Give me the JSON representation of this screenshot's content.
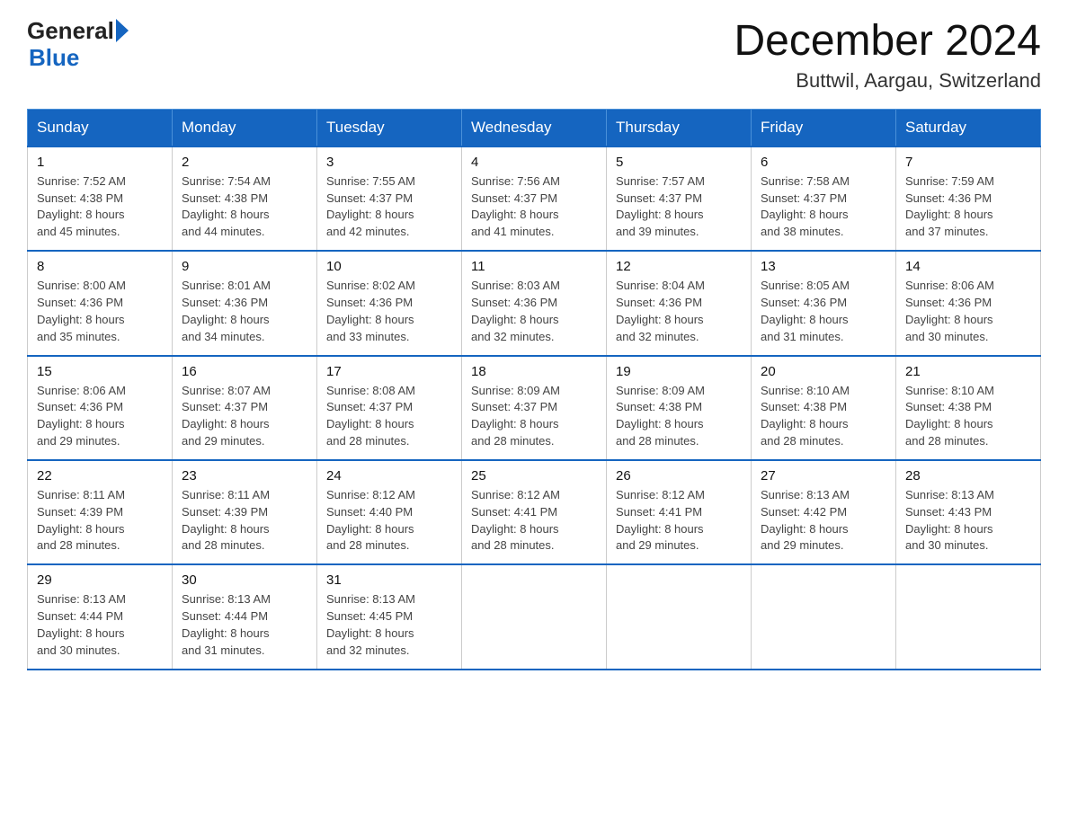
{
  "header": {
    "logo_general": "General",
    "logo_blue": "Blue",
    "month_title": "December 2024",
    "location": "Buttwil, Aargau, Switzerland"
  },
  "weekdays": [
    "Sunday",
    "Monday",
    "Tuesday",
    "Wednesday",
    "Thursday",
    "Friday",
    "Saturday"
  ],
  "weeks": [
    [
      {
        "day": "1",
        "sunrise": "7:52 AM",
        "sunset": "4:38 PM",
        "daylight": "8 hours and 45 minutes."
      },
      {
        "day": "2",
        "sunrise": "7:54 AM",
        "sunset": "4:38 PM",
        "daylight": "8 hours and 44 minutes."
      },
      {
        "day": "3",
        "sunrise": "7:55 AM",
        "sunset": "4:37 PM",
        "daylight": "8 hours and 42 minutes."
      },
      {
        "day": "4",
        "sunrise": "7:56 AM",
        "sunset": "4:37 PM",
        "daylight": "8 hours and 41 minutes."
      },
      {
        "day": "5",
        "sunrise": "7:57 AM",
        "sunset": "4:37 PM",
        "daylight": "8 hours and 39 minutes."
      },
      {
        "day": "6",
        "sunrise": "7:58 AM",
        "sunset": "4:37 PM",
        "daylight": "8 hours and 38 minutes."
      },
      {
        "day": "7",
        "sunrise": "7:59 AM",
        "sunset": "4:36 PM",
        "daylight": "8 hours and 37 minutes."
      }
    ],
    [
      {
        "day": "8",
        "sunrise": "8:00 AM",
        "sunset": "4:36 PM",
        "daylight": "8 hours and 35 minutes."
      },
      {
        "day": "9",
        "sunrise": "8:01 AM",
        "sunset": "4:36 PM",
        "daylight": "8 hours and 34 minutes."
      },
      {
        "day": "10",
        "sunrise": "8:02 AM",
        "sunset": "4:36 PM",
        "daylight": "8 hours and 33 minutes."
      },
      {
        "day": "11",
        "sunrise": "8:03 AM",
        "sunset": "4:36 PM",
        "daylight": "8 hours and 32 minutes."
      },
      {
        "day": "12",
        "sunrise": "8:04 AM",
        "sunset": "4:36 PM",
        "daylight": "8 hours and 32 minutes."
      },
      {
        "day": "13",
        "sunrise": "8:05 AM",
        "sunset": "4:36 PM",
        "daylight": "8 hours and 31 minutes."
      },
      {
        "day": "14",
        "sunrise": "8:06 AM",
        "sunset": "4:36 PM",
        "daylight": "8 hours and 30 minutes."
      }
    ],
    [
      {
        "day": "15",
        "sunrise": "8:06 AM",
        "sunset": "4:36 PM",
        "daylight": "8 hours and 29 minutes."
      },
      {
        "day": "16",
        "sunrise": "8:07 AM",
        "sunset": "4:37 PM",
        "daylight": "8 hours and 29 minutes."
      },
      {
        "day": "17",
        "sunrise": "8:08 AM",
        "sunset": "4:37 PM",
        "daylight": "8 hours and 28 minutes."
      },
      {
        "day": "18",
        "sunrise": "8:09 AM",
        "sunset": "4:37 PM",
        "daylight": "8 hours and 28 minutes."
      },
      {
        "day": "19",
        "sunrise": "8:09 AM",
        "sunset": "4:38 PM",
        "daylight": "8 hours and 28 minutes."
      },
      {
        "day": "20",
        "sunrise": "8:10 AM",
        "sunset": "4:38 PM",
        "daylight": "8 hours and 28 minutes."
      },
      {
        "day": "21",
        "sunrise": "8:10 AM",
        "sunset": "4:38 PM",
        "daylight": "8 hours and 28 minutes."
      }
    ],
    [
      {
        "day": "22",
        "sunrise": "8:11 AM",
        "sunset": "4:39 PM",
        "daylight": "8 hours and 28 minutes."
      },
      {
        "day": "23",
        "sunrise": "8:11 AM",
        "sunset": "4:39 PM",
        "daylight": "8 hours and 28 minutes."
      },
      {
        "day": "24",
        "sunrise": "8:12 AM",
        "sunset": "4:40 PM",
        "daylight": "8 hours and 28 minutes."
      },
      {
        "day": "25",
        "sunrise": "8:12 AM",
        "sunset": "4:41 PM",
        "daylight": "8 hours and 28 minutes."
      },
      {
        "day": "26",
        "sunrise": "8:12 AM",
        "sunset": "4:41 PM",
        "daylight": "8 hours and 29 minutes."
      },
      {
        "day": "27",
        "sunrise": "8:13 AM",
        "sunset": "4:42 PM",
        "daylight": "8 hours and 29 minutes."
      },
      {
        "day": "28",
        "sunrise": "8:13 AM",
        "sunset": "4:43 PM",
        "daylight": "8 hours and 30 minutes."
      }
    ],
    [
      {
        "day": "29",
        "sunrise": "8:13 AM",
        "sunset": "4:44 PM",
        "daylight": "8 hours and 30 minutes."
      },
      {
        "day": "30",
        "sunrise": "8:13 AM",
        "sunset": "4:44 PM",
        "daylight": "8 hours and 31 minutes."
      },
      {
        "day": "31",
        "sunrise": "8:13 AM",
        "sunset": "4:45 PM",
        "daylight": "8 hours and 32 minutes."
      },
      null,
      null,
      null,
      null
    ]
  ],
  "labels": {
    "sunrise": "Sunrise:",
    "sunset": "Sunset:",
    "daylight": "Daylight:"
  }
}
